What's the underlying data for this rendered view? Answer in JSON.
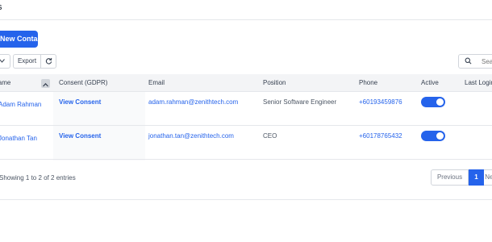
{
  "header": {
    "title": "s"
  },
  "toolbar": {
    "new_contact_label": "New Contact",
    "export_label": "Export",
    "search_placeholder": "Search"
  },
  "table": {
    "columns": [
      "Name",
      "Consent (GDPR)",
      "Email",
      "Position",
      "Phone",
      "Active",
      "Last Login"
    ],
    "rows": [
      {
        "name": "Adam Rahman",
        "consent": "View Consent",
        "email": "adam.rahman@zenithtech.com",
        "position": "Senior Software Engineer",
        "phone": "+60193459876",
        "active": true
      },
      {
        "name": "Jonathan Tan",
        "consent": "View Consent",
        "email": "jonathan.tan@zenithtech.com",
        "position": "CEO",
        "phone": "+60178765432",
        "active": true
      }
    ]
  },
  "footer": {
    "info": "Showing 1 to 2 of 2 entries",
    "prev_label": "Previous",
    "current_page": "1",
    "next_label": "Next"
  },
  "colors": {
    "accent": "#2563eb",
    "header_bg": "#f3f4f6",
    "border": "#e5e7eb"
  }
}
